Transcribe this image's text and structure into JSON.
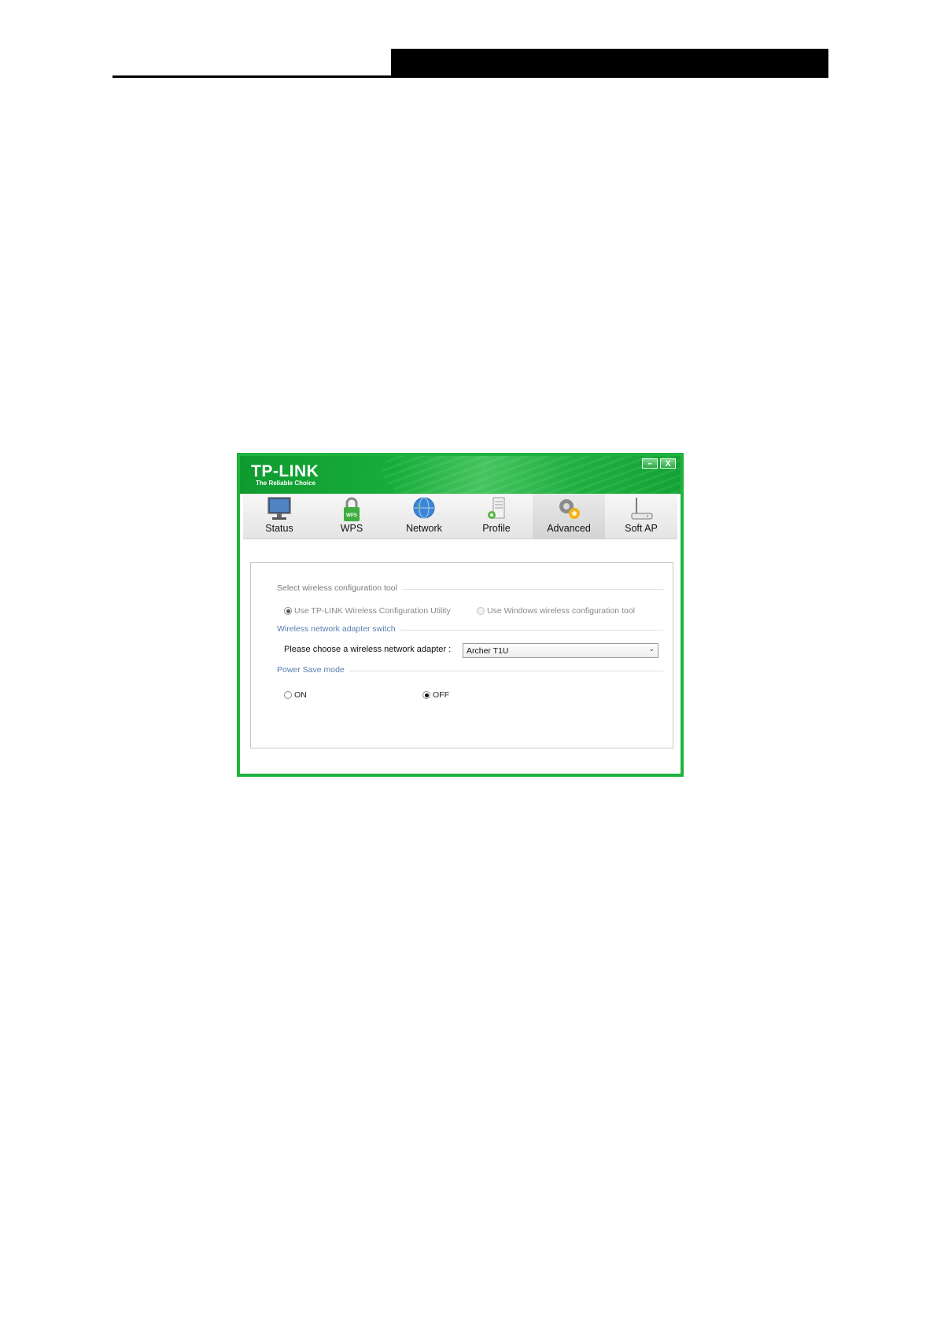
{
  "app": {
    "brand": "TP-LINK",
    "tagline": "The Reliable Choice",
    "minimize_glyph": "–",
    "close_glyph": "X"
  },
  "toolbar": {
    "tabs": [
      {
        "label": "Status",
        "icon": "monitor-icon"
      },
      {
        "label": "WPS",
        "icon": "wps-lock-icon"
      },
      {
        "label": "Network",
        "icon": "globe-icon"
      },
      {
        "label": "Profile",
        "icon": "profile-document-icon"
      },
      {
        "label": "Advanced",
        "icon": "gears-icon",
        "active": true
      },
      {
        "label": "Soft AP",
        "icon": "router-icon"
      }
    ]
  },
  "advanced": {
    "config_tool": {
      "heading": "Select wireless configuration tool",
      "option_tplink": "Use TP-LINK Wireless Configuration Utility",
      "option_windows": "Use Windows wireless configuration tool",
      "selected": "tplink"
    },
    "adapter_switch": {
      "heading": "Wireless network adapter switch",
      "label": "Please choose a wireless network adapter :",
      "selected_adapter": "Archer T1U"
    },
    "power_save": {
      "heading": "Power Save mode",
      "on_label": "ON",
      "off_label": "OFF",
      "selected": "OFF"
    }
  },
  "colors": {
    "brand_green": "#1fb33f",
    "section_blue": "#5a7db0"
  }
}
